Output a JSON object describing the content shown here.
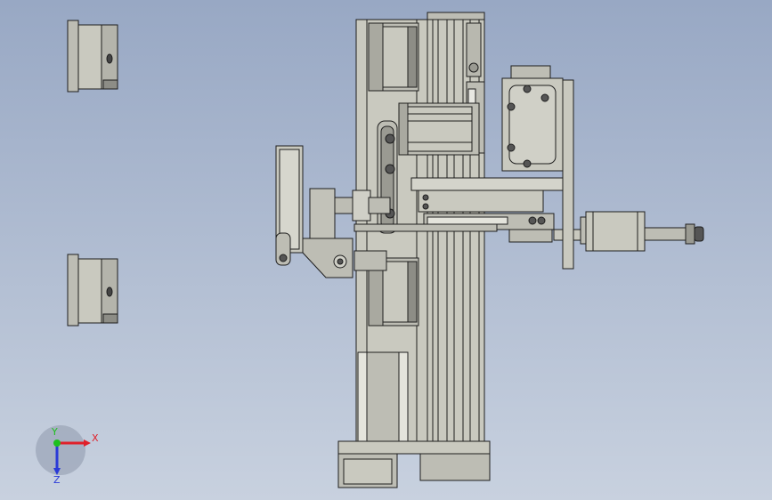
{
  "viewport": {
    "background_top": "#98a8c4",
    "background_bottom": "#c8d1df",
    "part_color": "#c9c9bf",
    "edge_color": "#1e1e1e",
    "shadow_color": "#8d8d86"
  },
  "triad": {
    "x_label": "X",
    "y_label": "Y",
    "z_label": "Z",
    "x_color": "#e0202a",
    "y_color": "#1ec01e",
    "z_color": "#2a3ad8"
  }
}
